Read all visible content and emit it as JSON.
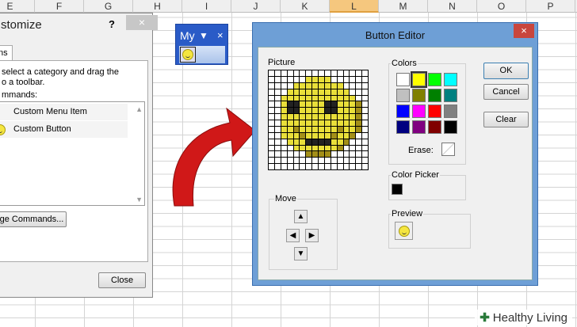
{
  "columns": [
    "E",
    "F",
    "G",
    "H",
    "I",
    "J",
    "K",
    "L",
    "M",
    "N",
    "O",
    "P"
  ],
  "selected_column": "L",
  "customize": {
    "title": "stomize",
    "help": "?",
    "close": "×",
    "tab": "ns",
    "instruction_line1": "select a category and drag the",
    "instruction_line2": "o a toolbar.",
    "commands_label": "mmands:",
    "items": [
      "Custom Menu Item",
      "Custom Button"
    ],
    "rearrange_button": "ge Commands...",
    "close_button": "Close"
  },
  "toolbar": {
    "name": "My",
    "dropdown": "▼",
    "close": "×"
  },
  "button_editor": {
    "title": "Button Editor",
    "close": "×",
    "picture_label": "Picture",
    "colors_label": "Colors",
    "colors": [
      "#ffffff",
      "#ffff00",
      "#00ff00",
      "#00ffff",
      "#c0c0c0",
      "#808000",
      "#008000",
      "#008080",
      "#0000ff",
      "#ff00ff",
      "#ff0000",
      "#808080",
      "#000080",
      "#800080",
      "#800000",
      "#000000"
    ],
    "selected_color": 1,
    "erase_label": "Erase:",
    "color_picker_label": "Color Picker",
    "picked_color": "#000000",
    "move_label": "Move",
    "preview_label": "Preview",
    "ok": "OK",
    "cancel": "Cancel",
    "clear": "Clear",
    "arrows": [
      "▲",
      "◀",
      "▶",
      "▼"
    ],
    "pixels": [
      "................",
      "......yyyy......",
      "....yyyyyyyy....",
      "...yyyyyyyyyy...",
      "..yyyyyyyyyyyy..",
      "..ykkyyyykkyyyo.",
      "..ykkyyyykkyyyo.",
      "..yyyyyyyyyyyyo.",
      "..yyyyyyyyyyyyo.",
      "..yyoyyyyyyoyyo.",
      "..yyyoyyyyoyyo..",
      "...yyykkkkyyo...",
      "....yyyyyyyo....",
      "......oooo......",
      "................",
      "................"
    ]
  },
  "logo": "Healthy Living"
}
